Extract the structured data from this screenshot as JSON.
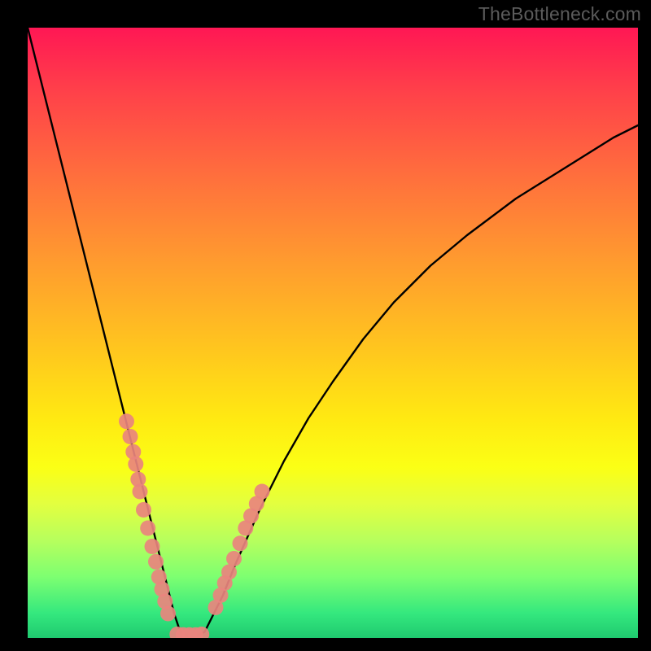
{
  "watermark": "TheBottleneck.com",
  "chart_data": {
    "type": "line",
    "title": "",
    "xlabel": "",
    "ylabel": "",
    "xlim": [
      0,
      100
    ],
    "ylim": [
      0,
      100
    ],
    "grid": false,
    "legend": false,
    "series": [
      {
        "name": "bottleneck-curve",
        "color": "#000000",
        "x": [
          0,
          2,
          4,
          6,
          8,
          10,
          12,
          14,
          16,
          18,
          20,
          21,
          22,
          23,
          24,
          25,
          27,
          29,
          30,
          32,
          34,
          38,
          42,
          46,
          50,
          55,
          60,
          66,
          72,
          80,
          88,
          96,
          100
        ],
        "y": [
          100,
          92,
          84,
          76,
          68,
          60,
          52,
          44,
          36,
          28,
          20,
          16,
          12,
          8,
          4,
          1,
          0,
          1,
          3,
          7,
          12,
          21,
          29,
          36,
          42,
          49,
          55,
          61,
          66,
          72,
          77,
          82,
          84
        ]
      }
    ],
    "markers": [
      {
        "name": "sample-points-left",
        "color": "#e9847e",
        "x": [
          16.2,
          16.8,
          17.3,
          17.7,
          18.1,
          18.4,
          19.0,
          19.7,
          20.4,
          21.0,
          21.5,
          22.0,
          22.5,
          23.0
        ],
        "y": [
          35.5,
          33.0,
          30.5,
          28.5,
          26.0,
          24.0,
          21.0,
          18.0,
          15.0,
          12.5,
          10.0,
          8.0,
          6.0,
          4.0
        ]
      },
      {
        "name": "flat-minimum",
        "color": "#e9847e",
        "x": [
          24.5,
          25.5,
          26.5,
          27.5,
          28.5
        ],
        "y": [
          0.6,
          0.5,
          0.5,
          0.5,
          0.6
        ]
      },
      {
        "name": "sample-points-right",
        "color": "#e9847e",
        "x": [
          30.8,
          31.6,
          32.3,
          33.0,
          33.8,
          34.8,
          35.7,
          36.6,
          37.5,
          38.4
        ],
        "y": [
          5.0,
          7.0,
          9.0,
          10.8,
          13.0,
          15.5,
          18.0,
          20.0,
          22.0,
          24.0
        ]
      }
    ]
  }
}
